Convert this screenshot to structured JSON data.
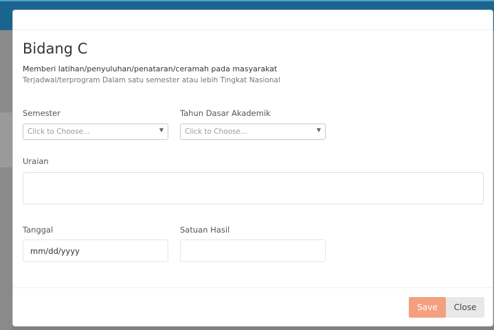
{
  "modal": {
    "title": "Bidang C",
    "description_line1": "Memberi latihan/penyuluhan/penataran/ceramah pada masyarakat",
    "description_line2": "Terjadwal/terprogram Dalam satu semester atau lebih Tingkat Nasional"
  },
  "form": {
    "semester": {
      "label": "Semester",
      "value": "Click to Choose..."
    },
    "tahun": {
      "label": "Tahun Dasar Akademik",
      "value": "Click to Choose..."
    },
    "uraian": {
      "label": "Uraian",
      "value": ""
    },
    "tanggal": {
      "label": "Tanggal",
      "value": "mm/dd/yyyy"
    },
    "satuan": {
      "label": "Satuan Hasil",
      "value": ""
    }
  },
  "buttons": {
    "save": "Save",
    "close": "Close"
  },
  "colors": {
    "topbar": "#1a6590",
    "save": "#f4a07f",
    "close": "#e8e8e8"
  },
  "icons": {
    "caret": "caret-down-icon"
  }
}
